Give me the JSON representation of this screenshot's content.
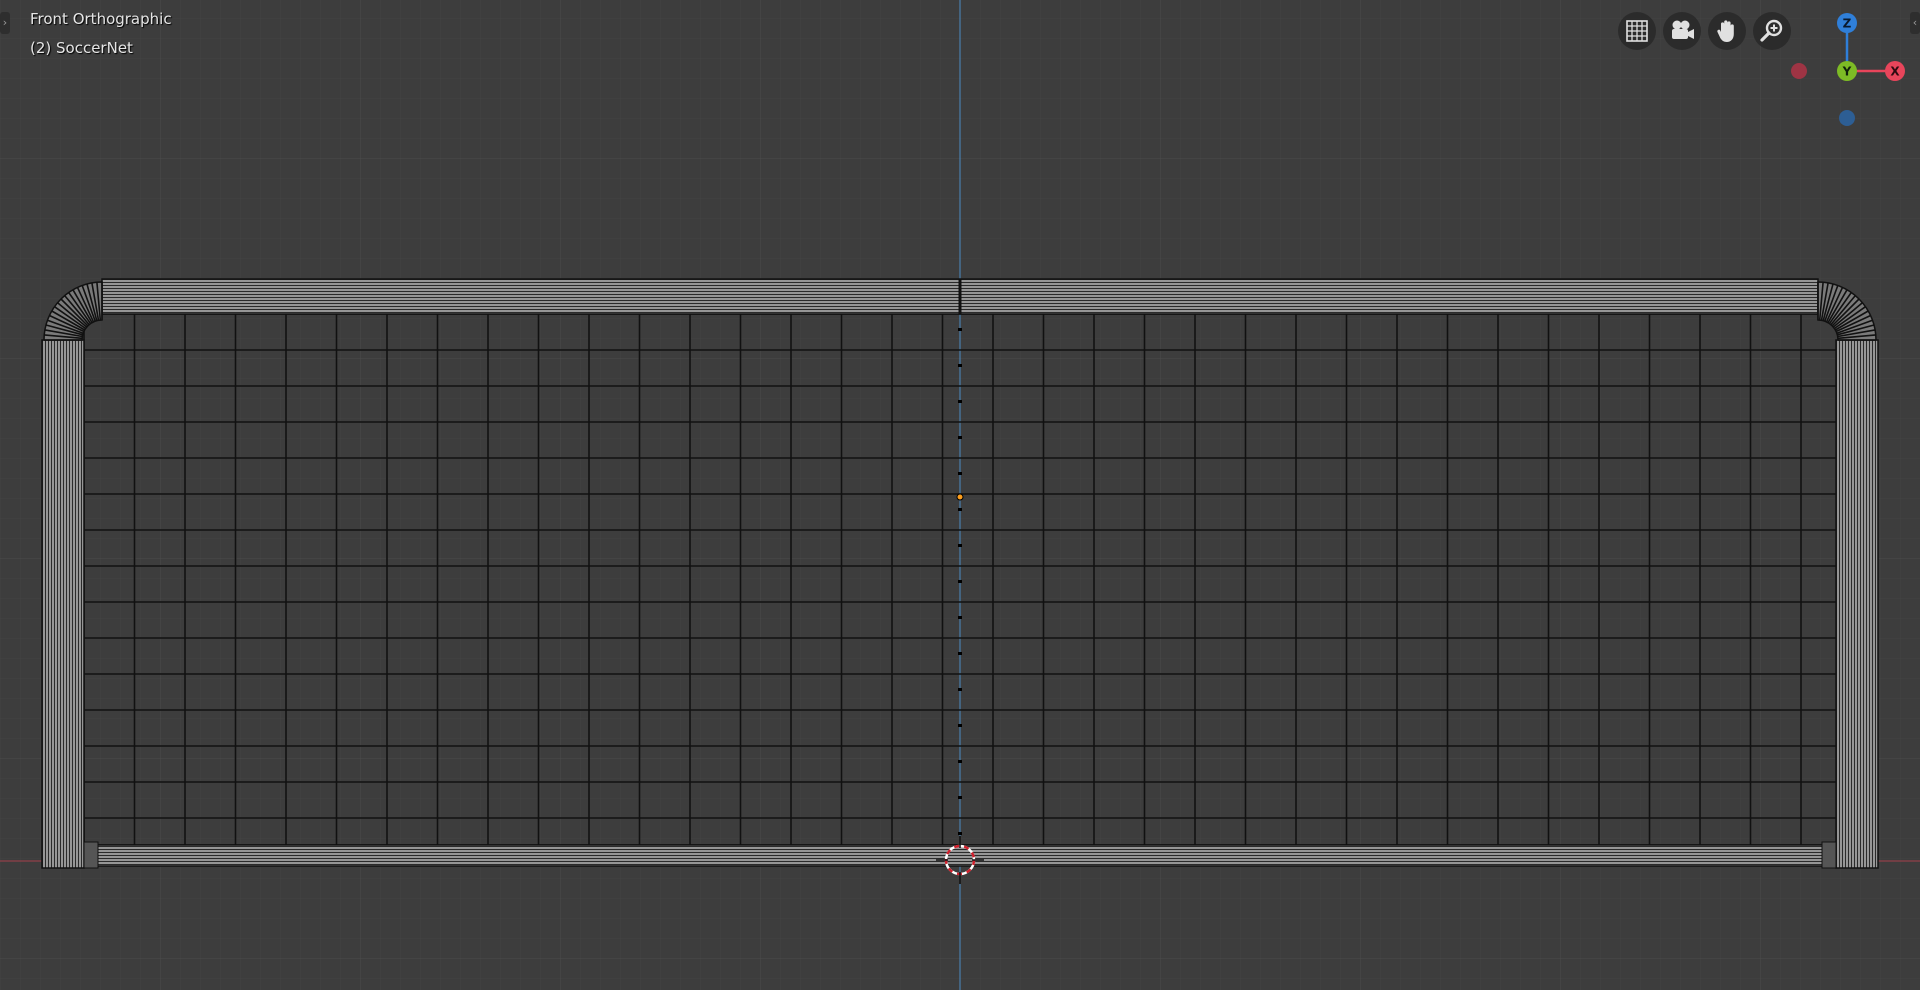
{
  "viewport": {
    "view_name": "Front Orthographic",
    "object_label": "(2) SoccerNet"
  },
  "nav_gizmo": {
    "z_label": "Z",
    "y_label": "Y",
    "x_label": "X",
    "colors": {
      "z": "#2f7fd9",
      "y": "#7dbb25",
      "x": "#e8455b",
      "neg_x": "#9e3444",
      "neg_z": "#2d5e94"
    }
  },
  "nav_buttons": [
    {
      "name": "toggle-perspective-button",
      "icon": "grid-icon"
    },
    {
      "name": "camera-view-button",
      "icon": "camera-icon"
    },
    {
      "name": "pan-view-button",
      "icon": "hand-icon"
    },
    {
      "name": "zoom-view-button",
      "icon": "magnifier-icon"
    }
  ],
  "colors": {
    "background": "#3d3d3d",
    "grid_minor": "#444444",
    "grid_major": "#4a4a4a",
    "axis_z": "#4a90c8",
    "axis_x": "#b03c46",
    "wire": "#111111",
    "pipe_fill": "#8f8f8f",
    "origin": "#ff9f1c"
  }
}
